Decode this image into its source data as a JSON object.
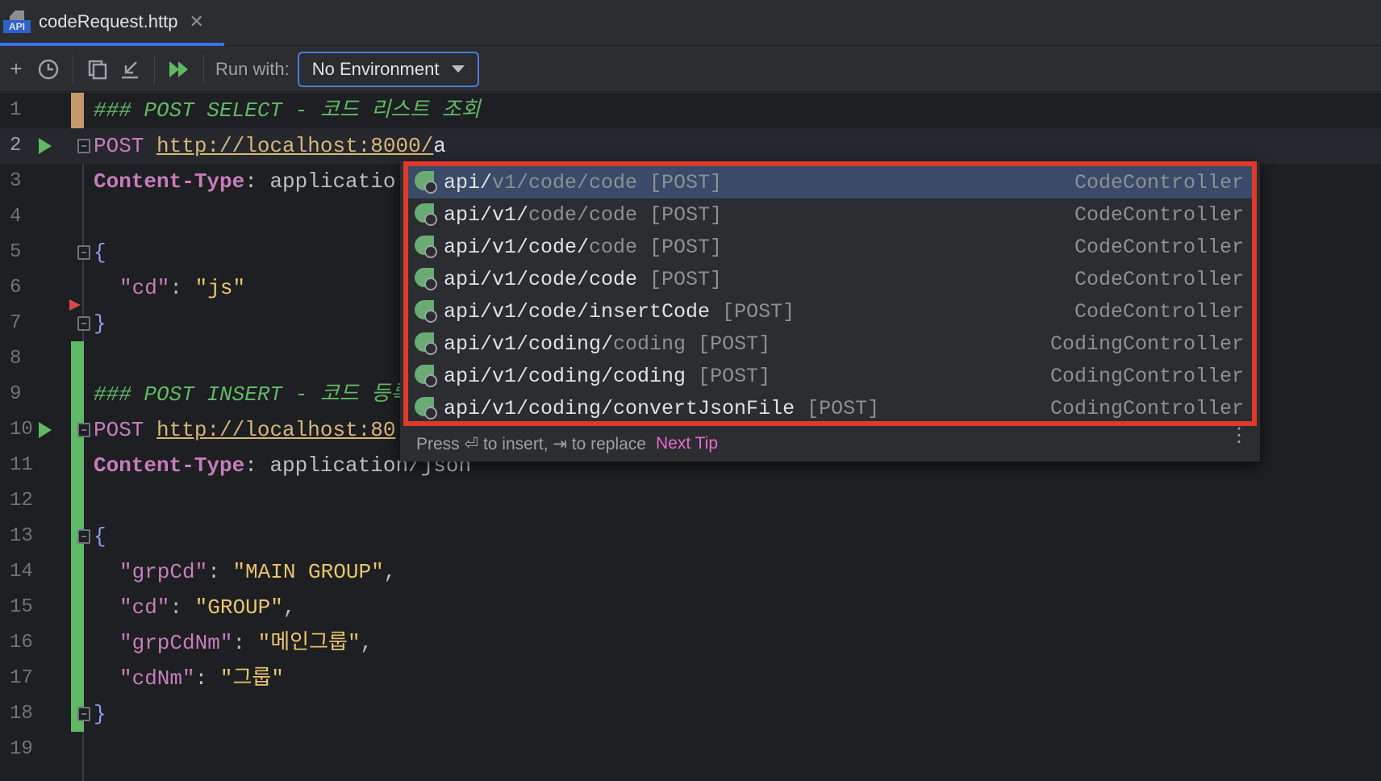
{
  "tab": {
    "icon_label": "API",
    "title": "codeRequest.http",
    "close_glyph": "✕"
  },
  "toolbar": {
    "add_glyph": "+",
    "history_glyph": "🕓",
    "copy_glyph": "⧉",
    "import_glyph": "↙",
    "run_all_glyph": "⏩",
    "run_with_label": "Run with:",
    "environment_value": "No Environment"
  },
  "editor": {
    "line_numbers": [
      "1",
      "2",
      "3",
      "4",
      "5",
      "6",
      "7",
      "8",
      "9",
      "10",
      "11",
      "12",
      "13",
      "14",
      "15",
      "16",
      "17",
      "18",
      "19"
    ],
    "line1": "### POST SELECT - 코드 리스트 조회",
    "line2_method": "POST",
    "line2_url": "http://localhost:8000/",
    "line2_typed": "a",
    "line3_header": "Content-Type",
    "line3_value": ": applicatio",
    "line5": "{",
    "line6_key": "\"cd\"",
    "line6_sep": ": ",
    "line6_val": "\"js\"",
    "line7": "}",
    "line9": "### POST INSERT - 코드 등록",
    "line10_method": "POST",
    "line10_url": "http://localhost:80",
    "line11_header": "Content-Type",
    "line11_value": ": application/json",
    "line13": "{",
    "line14_key": "\"grpCd\"",
    "line14_sep": ": ",
    "line14_val": "\"MAIN GROUP\"",
    "line14_end": ",",
    "line15_key": "\"cd\"",
    "line15_sep": ": ",
    "line15_val": "\"GROUP\"",
    "line15_end": ",",
    "line16_key": "\"grpCdNm\"",
    "line16_sep": ": ",
    "line16_val": "\"메인그룹\"",
    "line16_end": ",",
    "line17_key": "\"cdNm\"",
    "line17_sep": ": ",
    "line17_val": "\"그룹\"",
    "line18": "}"
  },
  "completion": {
    "items": [
      {
        "matched": "api/",
        "rest": "v1/code/code",
        "method": " [POST]",
        "controller": "CodeController"
      },
      {
        "matched": "api/v1/",
        "rest": "code/code",
        "method": " [POST]",
        "controller": "CodeController"
      },
      {
        "matched": "api/v1/code/",
        "rest": "code",
        "method": " [POST]",
        "controller": "CodeController"
      },
      {
        "matched": "api/v1/code/code",
        "rest": "",
        "method": " [POST]",
        "controller": "CodeController"
      },
      {
        "matched": "api/v1/code/insertCode",
        "rest": "",
        "method": " [POST]",
        "controller": "CodeController"
      },
      {
        "matched": "api/v1/coding/",
        "rest": "coding",
        "method": " [POST]",
        "controller": "CodingController"
      },
      {
        "matched": "api/v1/coding/coding",
        "rest": "",
        "method": " [POST]",
        "controller": "CodingController"
      },
      {
        "matched": "api/v1/coding/convertJsonFile",
        "rest": "",
        "method": " [POST]",
        "controller": "CodingController"
      }
    ],
    "footer_text": "Press ⏎ to insert, ⇥ to replace",
    "next_tip_label": "Next Tip",
    "more_glyph": "⋮"
  },
  "colors": {
    "accent": "#3574f0",
    "highlight_box": "#e0392b",
    "run_green": "#5fb865"
  }
}
